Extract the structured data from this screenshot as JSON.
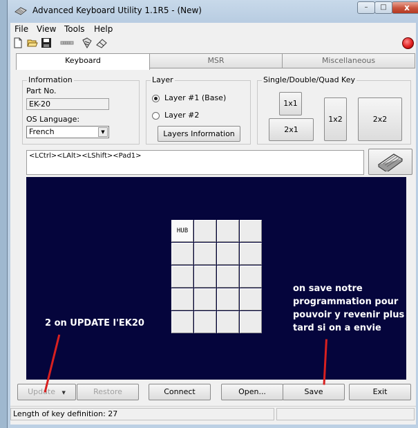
{
  "window": {
    "title": "Advanced Keyboard Utility 1.1R5  - (New)",
    "controls": {
      "minimize": "–",
      "maximize": "□",
      "close": "x"
    }
  },
  "menu": [
    "File",
    "View",
    "Tools",
    "Help"
  ],
  "toolbar": {
    "icons": [
      "new-document-icon",
      "open-folder-icon",
      "save-disk-icon",
      "magstripe-icon",
      "keyboard-icon",
      "eraser-icon",
      "stop-icon"
    ],
    "colors": {
      "stop": "#e02020"
    }
  },
  "tabs": [
    "Keyboard",
    "MSR",
    "Miscellaneous"
  ],
  "information": {
    "label": "Information",
    "part_no_label": "Part No.",
    "part_no_value": "EK-20",
    "os_language_label": "OS Language:",
    "os_language_value": "French"
  },
  "layer": {
    "label": "Layer",
    "options": [
      "Layer #1 (Base)",
      "Layer #2"
    ],
    "selected": 0,
    "info_button": "Layers Information"
  },
  "key_size": {
    "label": "Single/Double/Quad Key",
    "buttons": [
      "1x1",
      "2x1",
      "1x2",
      "2x2"
    ]
  },
  "key_definition": "<LCtrl><LAlt><LShift><Pad1>",
  "layout_grid": {
    "rows": 5,
    "cols": 4,
    "first_key": "HUB"
  },
  "annotations": {
    "update_note": "2 on UPDATE l'EK20",
    "save_note": [
      "on save notre",
      "programmation pour",
      "pouvoir y revenir plus",
      "tard si on a envie"
    ],
    "colors": {
      "canvas": "#05053c",
      "arrow": "#d82020"
    }
  },
  "buttons": {
    "update": "Update",
    "restore": "Restore",
    "connect": "Connect",
    "open": "Open...",
    "save": "Save",
    "exit": "Exit"
  },
  "status": {
    "length_text": "Length of key definition: 27"
  }
}
